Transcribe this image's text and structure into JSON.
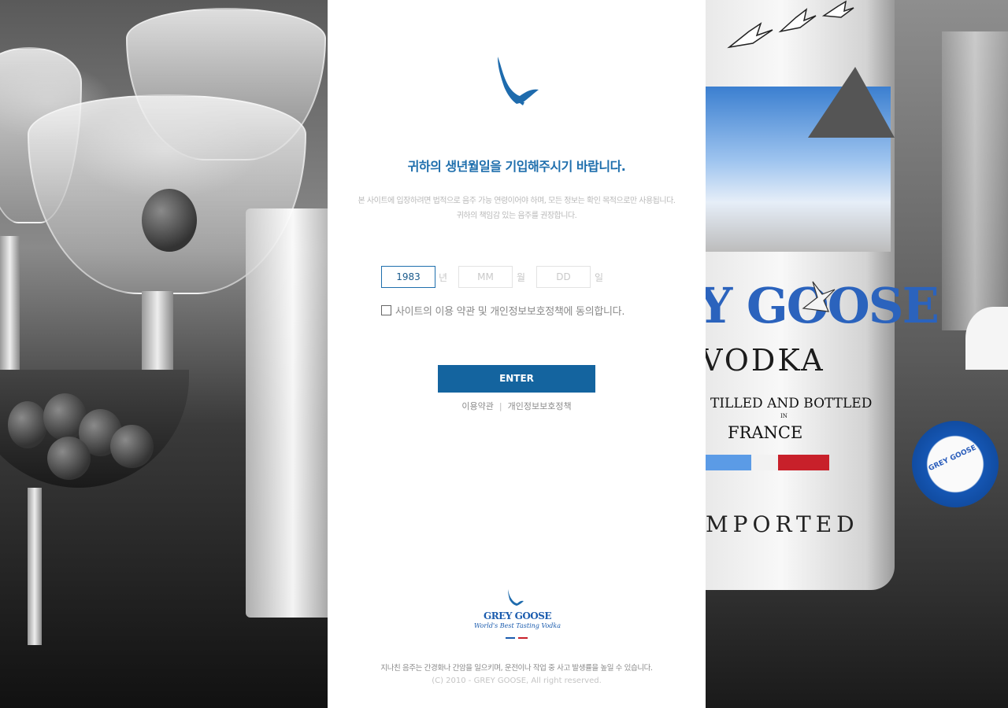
{
  "brand": {
    "logo_icon": "goose-icon",
    "primary_color": "#14649f",
    "headline_color": "#1f6fad"
  },
  "intro": {
    "headline": "귀하의 생년월일을 기입해주시기 바랍니다.",
    "desc_line1": "본 사이트에 입장하려면 법적으로 음주 가능 연령이어야 하며, 모든 정보는 확인 목적으로만 사용됩니다.",
    "desc_line2": "귀하의 책임감 있는 음주를 권장합니다."
  },
  "birth_form": {
    "year_value": "1983",
    "month_placeholder": "MM",
    "day_placeholder": "DD",
    "year_unit": "년",
    "month_unit": "월",
    "day_unit": "일"
  },
  "agreement": {
    "label": "사이트의 이용 약관 및 개인정보보호정책에 동의합니다.",
    "checked": false
  },
  "enter_button": {
    "label": "ENTER"
  },
  "footer_links": {
    "terms": "이용약관",
    "separator": "|",
    "privacy": "개인정보보호정책"
  },
  "footer": {
    "logo_name": "GREY GOOSE",
    "logo_tagline": "World's Best Tasting Vodka",
    "warning": "지나친 음주는 간경화나 간암을 일으키며, 운전이나 작업 중 사고 발생률을 높일 수 있습니다.",
    "copyright": "(C) 2010 - GREY GOOSE, All right reserved."
  }
}
